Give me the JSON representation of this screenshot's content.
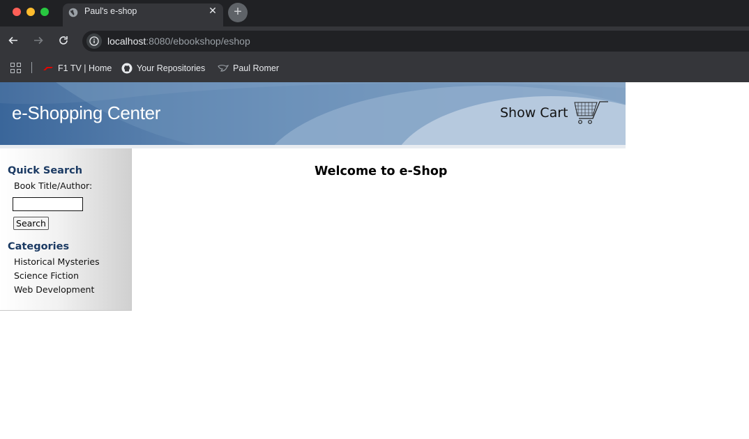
{
  "browser": {
    "tab_title": "Paul's e-shop",
    "url_host": "localhost",
    "url_path": ":8080/ebookshop/eshop",
    "bookmarks": [
      {
        "label": "F1 TV | Home",
        "icon": "f1-logo-icon"
      },
      {
        "label": "Your Repositories",
        "icon": "github-icon"
      },
      {
        "label": "Paul Romer",
        "icon": "bird-icon"
      }
    ]
  },
  "banner": {
    "title": "e-Shopping Center",
    "cart_label": "Show Cart",
    "cart_icon": "shopping-cart-icon"
  },
  "sidebar": {
    "search_heading": "Quick Search",
    "search_label": "Book Title/Author:",
    "search_value": "",
    "search_button": "Search",
    "categories_heading": "Categories",
    "categories": [
      "Historical Mysteries",
      "Science Fiction",
      "Web Development"
    ]
  },
  "main": {
    "welcome": "Welcome to e-Shop"
  },
  "colors": {
    "banner_dark": "#3d6c9f",
    "banner_light": "#b6c9de",
    "heading_blue": "#1b3a63"
  }
}
